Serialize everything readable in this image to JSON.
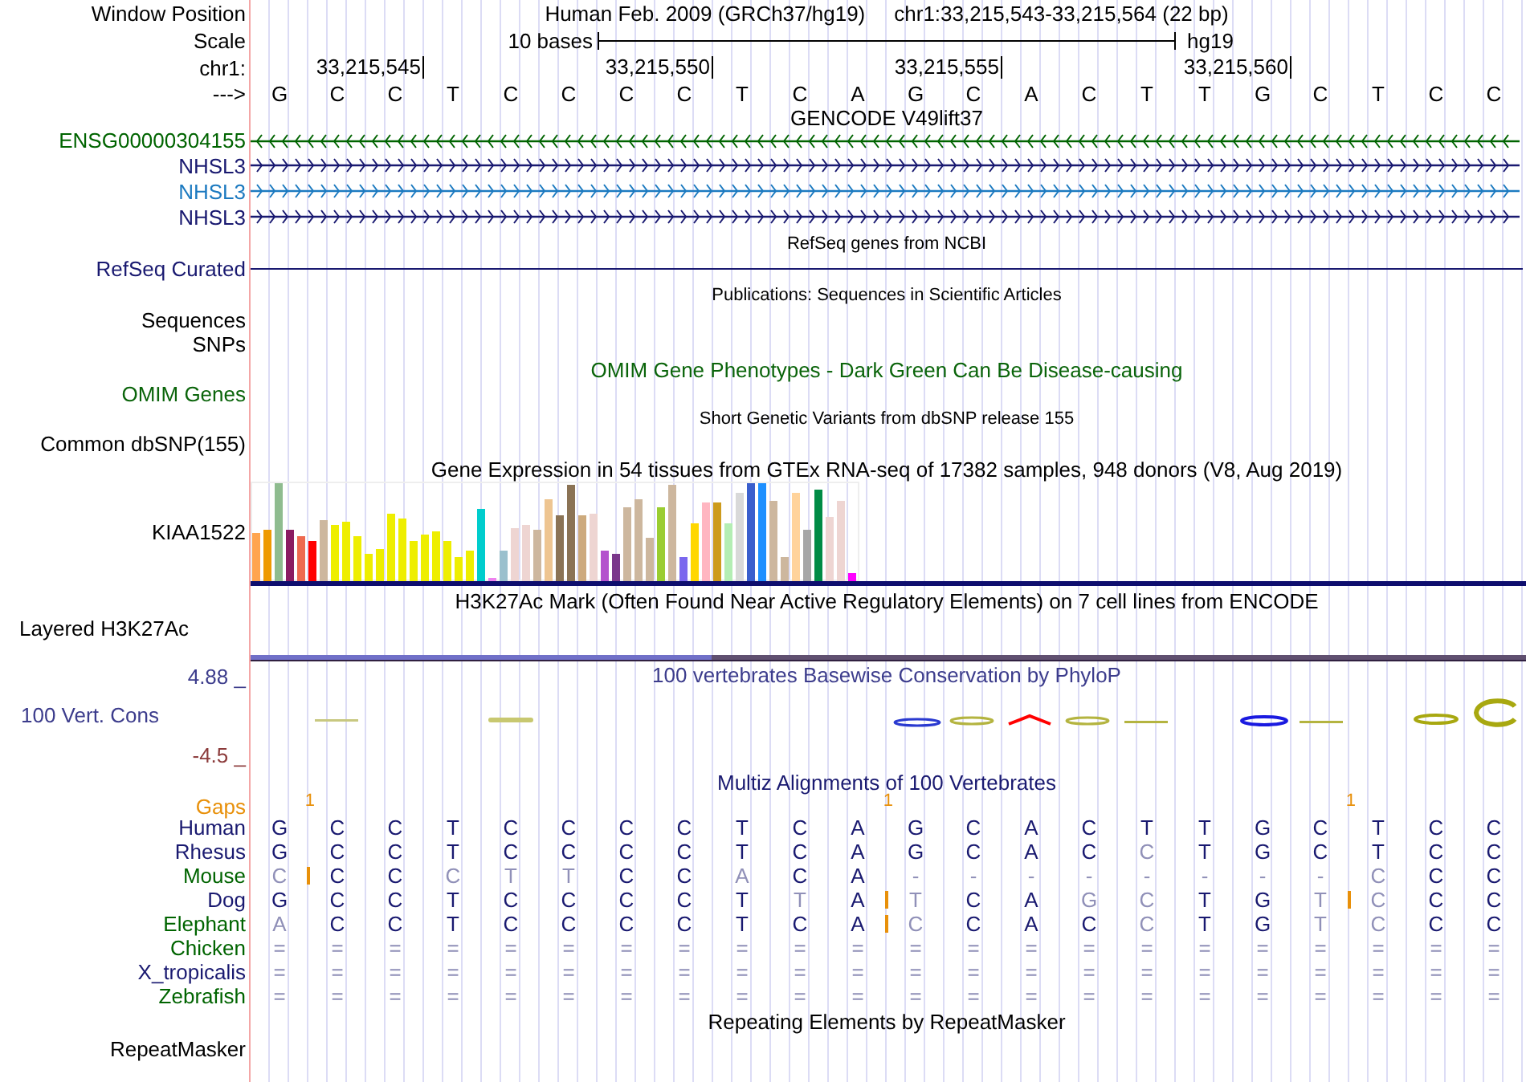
{
  "window_position": {
    "label": "Window Position",
    "assembly": "Human Feb. 2009 (GRCh37/hg19)",
    "range": "chr1:33,215,543-33,215,564 (22 bp)"
  },
  "scale": {
    "label": "Scale",
    "bar_label": "10 bases",
    "assembly": "hg19"
  },
  "ruler": {
    "label": "chr1:",
    "ticks": [
      "33,215,545",
      "33,215,550",
      "33,215,555",
      "33,215,560"
    ]
  },
  "sequence": {
    "label": "--->",
    "bases": [
      "G",
      "C",
      "C",
      "T",
      "C",
      "C",
      "C",
      "C",
      "T",
      "C",
      "A",
      "G",
      "C",
      "A",
      "C",
      "T",
      "T",
      "G",
      "C",
      "T",
      "C",
      "C"
    ]
  },
  "gencode": {
    "title": "GENCODE V49lift37",
    "genes": [
      {
        "name": "ENSG00000304155",
        "reverse_strand": true,
        "color": "#006400"
      },
      {
        "name": "NHSL3",
        "reverse_strand": false,
        "color": "#191970"
      },
      {
        "name": "NHSL3",
        "reverse_strand": false,
        "color": "#1c7ac0"
      },
      {
        "name": "NHSL3",
        "reverse_strand": false,
        "color": "#191970"
      }
    ]
  },
  "refseq": {
    "title": "RefSeq genes from NCBI",
    "label": "RefSeq Curated"
  },
  "publications": {
    "title": "Publications: Sequences in Scientific Articles",
    "labels": [
      "Sequences",
      "SNPs"
    ]
  },
  "omim": {
    "title": "OMIM Gene Phenotypes - Dark Green Can Be Disease-causing",
    "label": "OMIM Genes"
  },
  "dbsnp": {
    "title": "Short Genetic Variants from dbSNP release 155",
    "label": "Common dbSNP(155)"
  },
  "gtex": {
    "title": "Gene Expression in 54 tissues from GTEx RNA-seq of 17382 samples, 948 donors (V8, Aug 2019)",
    "label": "KIAA1522"
  },
  "h3k27ac": {
    "title": "H3K27Ac Mark (Often Found Near Active Regulatory Elements) on 7 cell lines from ENCODE",
    "label": "Layered H3K27Ac"
  },
  "conservation": {
    "title": "100 vertebrates Basewise Conservation by PhyloP",
    "label": "100 Vert. Cons",
    "max_label": "4.88 _",
    "min_label": "-4.5 _"
  },
  "multiz": {
    "title": "Multiz Alignments of 100 Vertebrates",
    "gaps_label": "Gaps",
    "gap_counts": [
      "1",
      "1",
      "1"
    ],
    "species": [
      {
        "name": "Human",
        "color": "#191970",
        "cells": [
          {
            "base": "G",
            "match": true,
            "insert": false
          },
          {
            "base": "C",
            "match": true,
            "insert": false
          },
          {
            "base": "C",
            "match": true,
            "insert": false
          },
          {
            "base": "T",
            "match": true,
            "insert": false
          },
          {
            "base": "C",
            "match": true,
            "insert": false
          },
          {
            "base": "C",
            "match": true,
            "insert": false
          },
          {
            "base": "C",
            "match": true,
            "insert": false
          },
          {
            "base": "C",
            "match": true,
            "insert": false
          },
          {
            "base": "T",
            "match": true,
            "insert": false
          },
          {
            "base": "C",
            "match": true,
            "insert": false
          },
          {
            "base": "A",
            "match": true,
            "insert": false
          },
          {
            "base": "G",
            "match": true,
            "insert": false
          },
          {
            "base": "C",
            "match": true,
            "insert": false
          },
          {
            "base": "A",
            "match": true,
            "insert": false
          },
          {
            "base": "C",
            "match": true,
            "insert": false
          },
          {
            "base": "T",
            "match": true,
            "insert": false
          },
          {
            "base": "T",
            "match": true,
            "insert": false
          },
          {
            "base": "G",
            "match": true,
            "insert": false
          },
          {
            "base": "C",
            "match": true,
            "insert": false
          },
          {
            "base": "T",
            "match": true,
            "insert": false
          },
          {
            "base": "C",
            "match": true,
            "insert": false
          },
          {
            "base": "C",
            "match": true,
            "insert": false
          }
        ]
      },
      {
        "name": "Rhesus",
        "color": "#191970",
        "cells": [
          {
            "base": "G",
            "match": true,
            "insert": false
          },
          {
            "base": "C",
            "match": true,
            "insert": false
          },
          {
            "base": "C",
            "match": true,
            "insert": false
          },
          {
            "base": "T",
            "match": true,
            "insert": false
          },
          {
            "base": "C",
            "match": true,
            "insert": false
          },
          {
            "base": "C",
            "match": true,
            "insert": false
          },
          {
            "base": "C",
            "match": true,
            "insert": false
          },
          {
            "base": "C",
            "match": true,
            "insert": false
          },
          {
            "base": "T",
            "match": true,
            "insert": false
          },
          {
            "base": "C",
            "match": true,
            "insert": false
          },
          {
            "base": "A",
            "match": true,
            "insert": false
          },
          {
            "base": "G",
            "match": true,
            "insert": false
          },
          {
            "base": "C",
            "match": true,
            "insert": false
          },
          {
            "base": "A",
            "match": true,
            "insert": false
          },
          {
            "base": "C",
            "match": true,
            "insert": false
          },
          {
            "base": "C",
            "match": false,
            "insert": false
          },
          {
            "base": "T",
            "match": true,
            "insert": false
          },
          {
            "base": "G",
            "match": true,
            "insert": false
          },
          {
            "base": "C",
            "match": true,
            "insert": false
          },
          {
            "base": "T",
            "match": true,
            "insert": false
          },
          {
            "base": "C",
            "match": true,
            "insert": false
          },
          {
            "base": "C",
            "match": true,
            "insert": false
          }
        ]
      },
      {
        "name": "Mouse",
        "color": "#006400",
        "cells": [
          {
            "base": "C",
            "match": false,
            "insert": true
          },
          {
            "base": "C",
            "match": true,
            "insert": false
          },
          {
            "base": "C",
            "match": true,
            "insert": false
          },
          {
            "base": "C",
            "match": false,
            "insert": false
          },
          {
            "base": "T",
            "match": false,
            "insert": false
          },
          {
            "base": "T",
            "match": false,
            "insert": false
          },
          {
            "base": "C",
            "match": true,
            "insert": false
          },
          {
            "base": "C",
            "match": true,
            "insert": false
          },
          {
            "base": "A",
            "match": false,
            "insert": false
          },
          {
            "base": "C",
            "match": true,
            "insert": false
          },
          {
            "base": "A",
            "match": true,
            "insert": false
          },
          {
            "base": "-",
            "match": false,
            "insert": false
          },
          {
            "base": "-",
            "match": false,
            "insert": false
          },
          {
            "base": "-",
            "match": false,
            "insert": false
          },
          {
            "base": "-",
            "match": false,
            "insert": false
          },
          {
            "base": "-",
            "match": false,
            "insert": false
          },
          {
            "base": "-",
            "match": false,
            "insert": false
          },
          {
            "base": "-",
            "match": false,
            "insert": false
          },
          {
            "base": "-",
            "match": false,
            "insert": false
          },
          {
            "base": "C",
            "match": false,
            "insert": false
          },
          {
            "base": "C",
            "match": true,
            "insert": false
          },
          {
            "base": "C",
            "match": true,
            "insert": false
          }
        ]
      },
      {
        "name": "Dog",
        "color": "#191970",
        "cells": [
          {
            "base": "G",
            "match": true,
            "insert": false
          },
          {
            "base": "C",
            "match": true,
            "insert": false
          },
          {
            "base": "C",
            "match": true,
            "insert": false
          },
          {
            "base": "T",
            "match": true,
            "insert": false
          },
          {
            "base": "C",
            "match": true,
            "insert": false
          },
          {
            "base": "C",
            "match": true,
            "insert": false
          },
          {
            "base": "C",
            "match": true,
            "insert": false
          },
          {
            "base": "C",
            "match": true,
            "insert": false
          },
          {
            "base": "T",
            "match": true,
            "insert": false
          },
          {
            "base": "T",
            "match": false,
            "insert": false
          },
          {
            "base": "A",
            "match": true,
            "insert": true
          },
          {
            "base": "T",
            "match": false,
            "insert": false
          },
          {
            "base": "C",
            "match": true,
            "insert": false
          },
          {
            "base": "A",
            "match": true,
            "insert": false
          },
          {
            "base": "G",
            "match": false,
            "insert": false
          },
          {
            "base": "C",
            "match": false,
            "insert": false
          },
          {
            "base": "T",
            "match": true,
            "insert": false
          },
          {
            "base": "G",
            "match": true,
            "insert": false
          },
          {
            "base": "T",
            "match": false,
            "insert": true
          },
          {
            "base": "C",
            "match": false,
            "insert": false
          },
          {
            "base": "C",
            "match": true,
            "insert": false
          },
          {
            "base": "C",
            "match": true,
            "insert": false
          }
        ]
      },
      {
        "name": "Elephant",
        "color": "#006400",
        "cells": [
          {
            "base": "A",
            "match": false,
            "insert": false
          },
          {
            "base": "C",
            "match": true,
            "insert": false
          },
          {
            "base": "C",
            "match": true,
            "insert": false
          },
          {
            "base": "T",
            "match": true,
            "insert": false
          },
          {
            "base": "C",
            "match": true,
            "insert": false
          },
          {
            "base": "C",
            "match": true,
            "insert": false
          },
          {
            "base": "C",
            "match": true,
            "insert": false
          },
          {
            "base": "C",
            "match": true,
            "insert": false
          },
          {
            "base": "T",
            "match": true,
            "insert": false
          },
          {
            "base": "C",
            "match": true,
            "insert": false
          },
          {
            "base": "A",
            "match": true,
            "insert": true
          },
          {
            "base": "C",
            "match": false,
            "insert": false
          },
          {
            "base": "C",
            "match": true,
            "insert": false
          },
          {
            "base": "A",
            "match": true,
            "insert": false
          },
          {
            "base": "C",
            "match": true,
            "insert": false
          },
          {
            "base": "C",
            "match": false,
            "insert": false
          },
          {
            "base": "T",
            "match": true,
            "insert": false
          },
          {
            "base": "G",
            "match": true,
            "insert": false
          },
          {
            "base": "T",
            "match": false,
            "insert": false
          },
          {
            "base": "C",
            "match": false,
            "insert": false
          },
          {
            "base": "C",
            "match": true,
            "insert": false
          },
          {
            "base": "C",
            "match": true,
            "insert": false
          }
        ]
      },
      {
        "name": "Chicken",
        "color": "#006400",
        "cells": [
          {
            "base": "=",
            "match": false,
            "insert": false
          },
          {
            "base": "=",
            "match": false,
            "insert": false
          },
          {
            "base": "=",
            "match": false,
            "insert": false
          },
          {
            "base": "=",
            "match": false,
            "insert": false
          },
          {
            "base": "=",
            "match": false,
            "insert": false
          },
          {
            "base": "=",
            "match": false,
            "insert": false
          },
          {
            "base": "=",
            "match": false,
            "insert": false
          },
          {
            "base": "=",
            "match": false,
            "insert": false
          },
          {
            "base": "=",
            "match": false,
            "insert": false
          },
          {
            "base": "=",
            "match": false,
            "insert": false
          },
          {
            "base": "=",
            "match": false,
            "insert": false
          },
          {
            "base": "=",
            "match": false,
            "insert": false
          },
          {
            "base": "=",
            "match": false,
            "insert": false
          },
          {
            "base": "=",
            "match": false,
            "insert": false
          },
          {
            "base": "=",
            "match": false,
            "insert": false
          },
          {
            "base": "=",
            "match": false,
            "insert": false
          },
          {
            "base": "=",
            "match": false,
            "insert": false
          },
          {
            "base": "=",
            "match": false,
            "insert": false
          },
          {
            "base": "=",
            "match": false,
            "insert": false
          },
          {
            "base": "=",
            "match": false,
            "insert": false
          },
          {
            "base": "=",
            "match": false,
            "insert": false
          },
          {
            "base": "=",
            "match": false,
            "insert": false
          }
        ]
      },
      {
        "name": "X_tropicalis",
        "color": "#191970",
        "cells": [
          {
            "base": "=",
            "match": false,
            "insert": false
          },
          {
            "base": "=",
            "match": false,
            "insert": false
          },
          {
            "base": "=",
            "match": false,
            "insert": false
          },
          {
            "base": "=",
            "match": false,
            "insert": false
          },
          {
            "base": "=",
            "match": false,
            "insert": false
          },
          {
            "base": "=",
            "match": false,
            "insert": false
          },
          {
            "base": "=",
            "match": false,
            "insert": false
          },
          {
            "base": "=",
            "match": false,
            "insert": false
          },
          {
            "base": "=",
            "match": false,
            "insert": false
          },
          {
            "base": "=",
            "match": false,
            "insert": false
          },
          {
            "base": "=",
            "match": false,
            "insert": false
          },
          {
            "base": "=",
            "match": false,
            "insert": false
          },
          {
            "base": "=",
            "match": false,
            "insert": false
          },
          {
            "base": "=",
            "match": false,
            "insert": false
          },
          {
            "base": "=",
            "match": false,
            "insert": false
          },
          {
            "base": "=",
            "match": false,
            "insert": false
          },
          {
            "base": "=",
            "match": false,
            "insert": false
          },
          {
            "base": "=",
            "match": false,
            "insert": false
          },
          {
            "base": "=",
            "match": false,
            "insert": false
          },
          {
            "base": "=",
            "match": false,
            "insert": false
          },
          {
            "base": "=",
            "match": false,
            "insert": false
          },
          {
            "base": "=",
            "match": false,
            "insert": false
          }
        ]
      },
      {
        "name": "Zebrafish",
        "color": "#006400",
        "cells": [
          {
            "base": "=",
            "match": false,
            "insert": false
          },
          {
            "base": "=",
            "match": false,
            "insert": false
          },
          {
            "base": "=",
            "match": false,
            "insert": false
          },
          {
            "base": "=",
            "match": false,
            "insert": false
          },
          {
            "base": "=",
            "match": false,
            "insert": false
          },
          {
            "base": "=",
            "match": false,
            "insert": false
          },
          {
            "base": "=",
            "match": false,
            "insert": false
          },
          {
            "base": "=",
            "match": false,
            "insert": false
          },
          {
            "base": "=",
            "match": false,
            "insert": false
          },
          {
            "base": "=",
            "match": false,
            "insert": false
          },
          {
            "base": "=",
            "match": false,
            "insert": false
          },
          {
            "base": "=",
            "match": false,
            "insert": false
          },
          {
            "base": "=",
            "match": false,
            "insert": false
          },
          {
            "base": "=",
            "match": false,
            "insert": false
          },
          {
            "base": "=",
            "match": false,
            "insert": false
          },
          {
            "base": "=",
            "match": false,
            "insert": false
          },
          {
            "base": "=",
            "match": false,
            "insert": false
          },
          {
            "base": "=",
            "match": false,
            "insert": false
          },
          {
            "base": "=",
            "match": false,
            "insert": false
          },
          {
            "base": "=",
            "match": false,
            "insert": false
          },
          {
            "base": "=",
            "match": false,
            "insert": false
          },
          {
            "base": "=",
            "match": false,
            "insert": false
          }
        ]
      }
    ]
  },
  "repeatmasker": {
    "title": "Repeating Elements by RepeatMasker",
    "label": "RepeatMasker"
  }
}
